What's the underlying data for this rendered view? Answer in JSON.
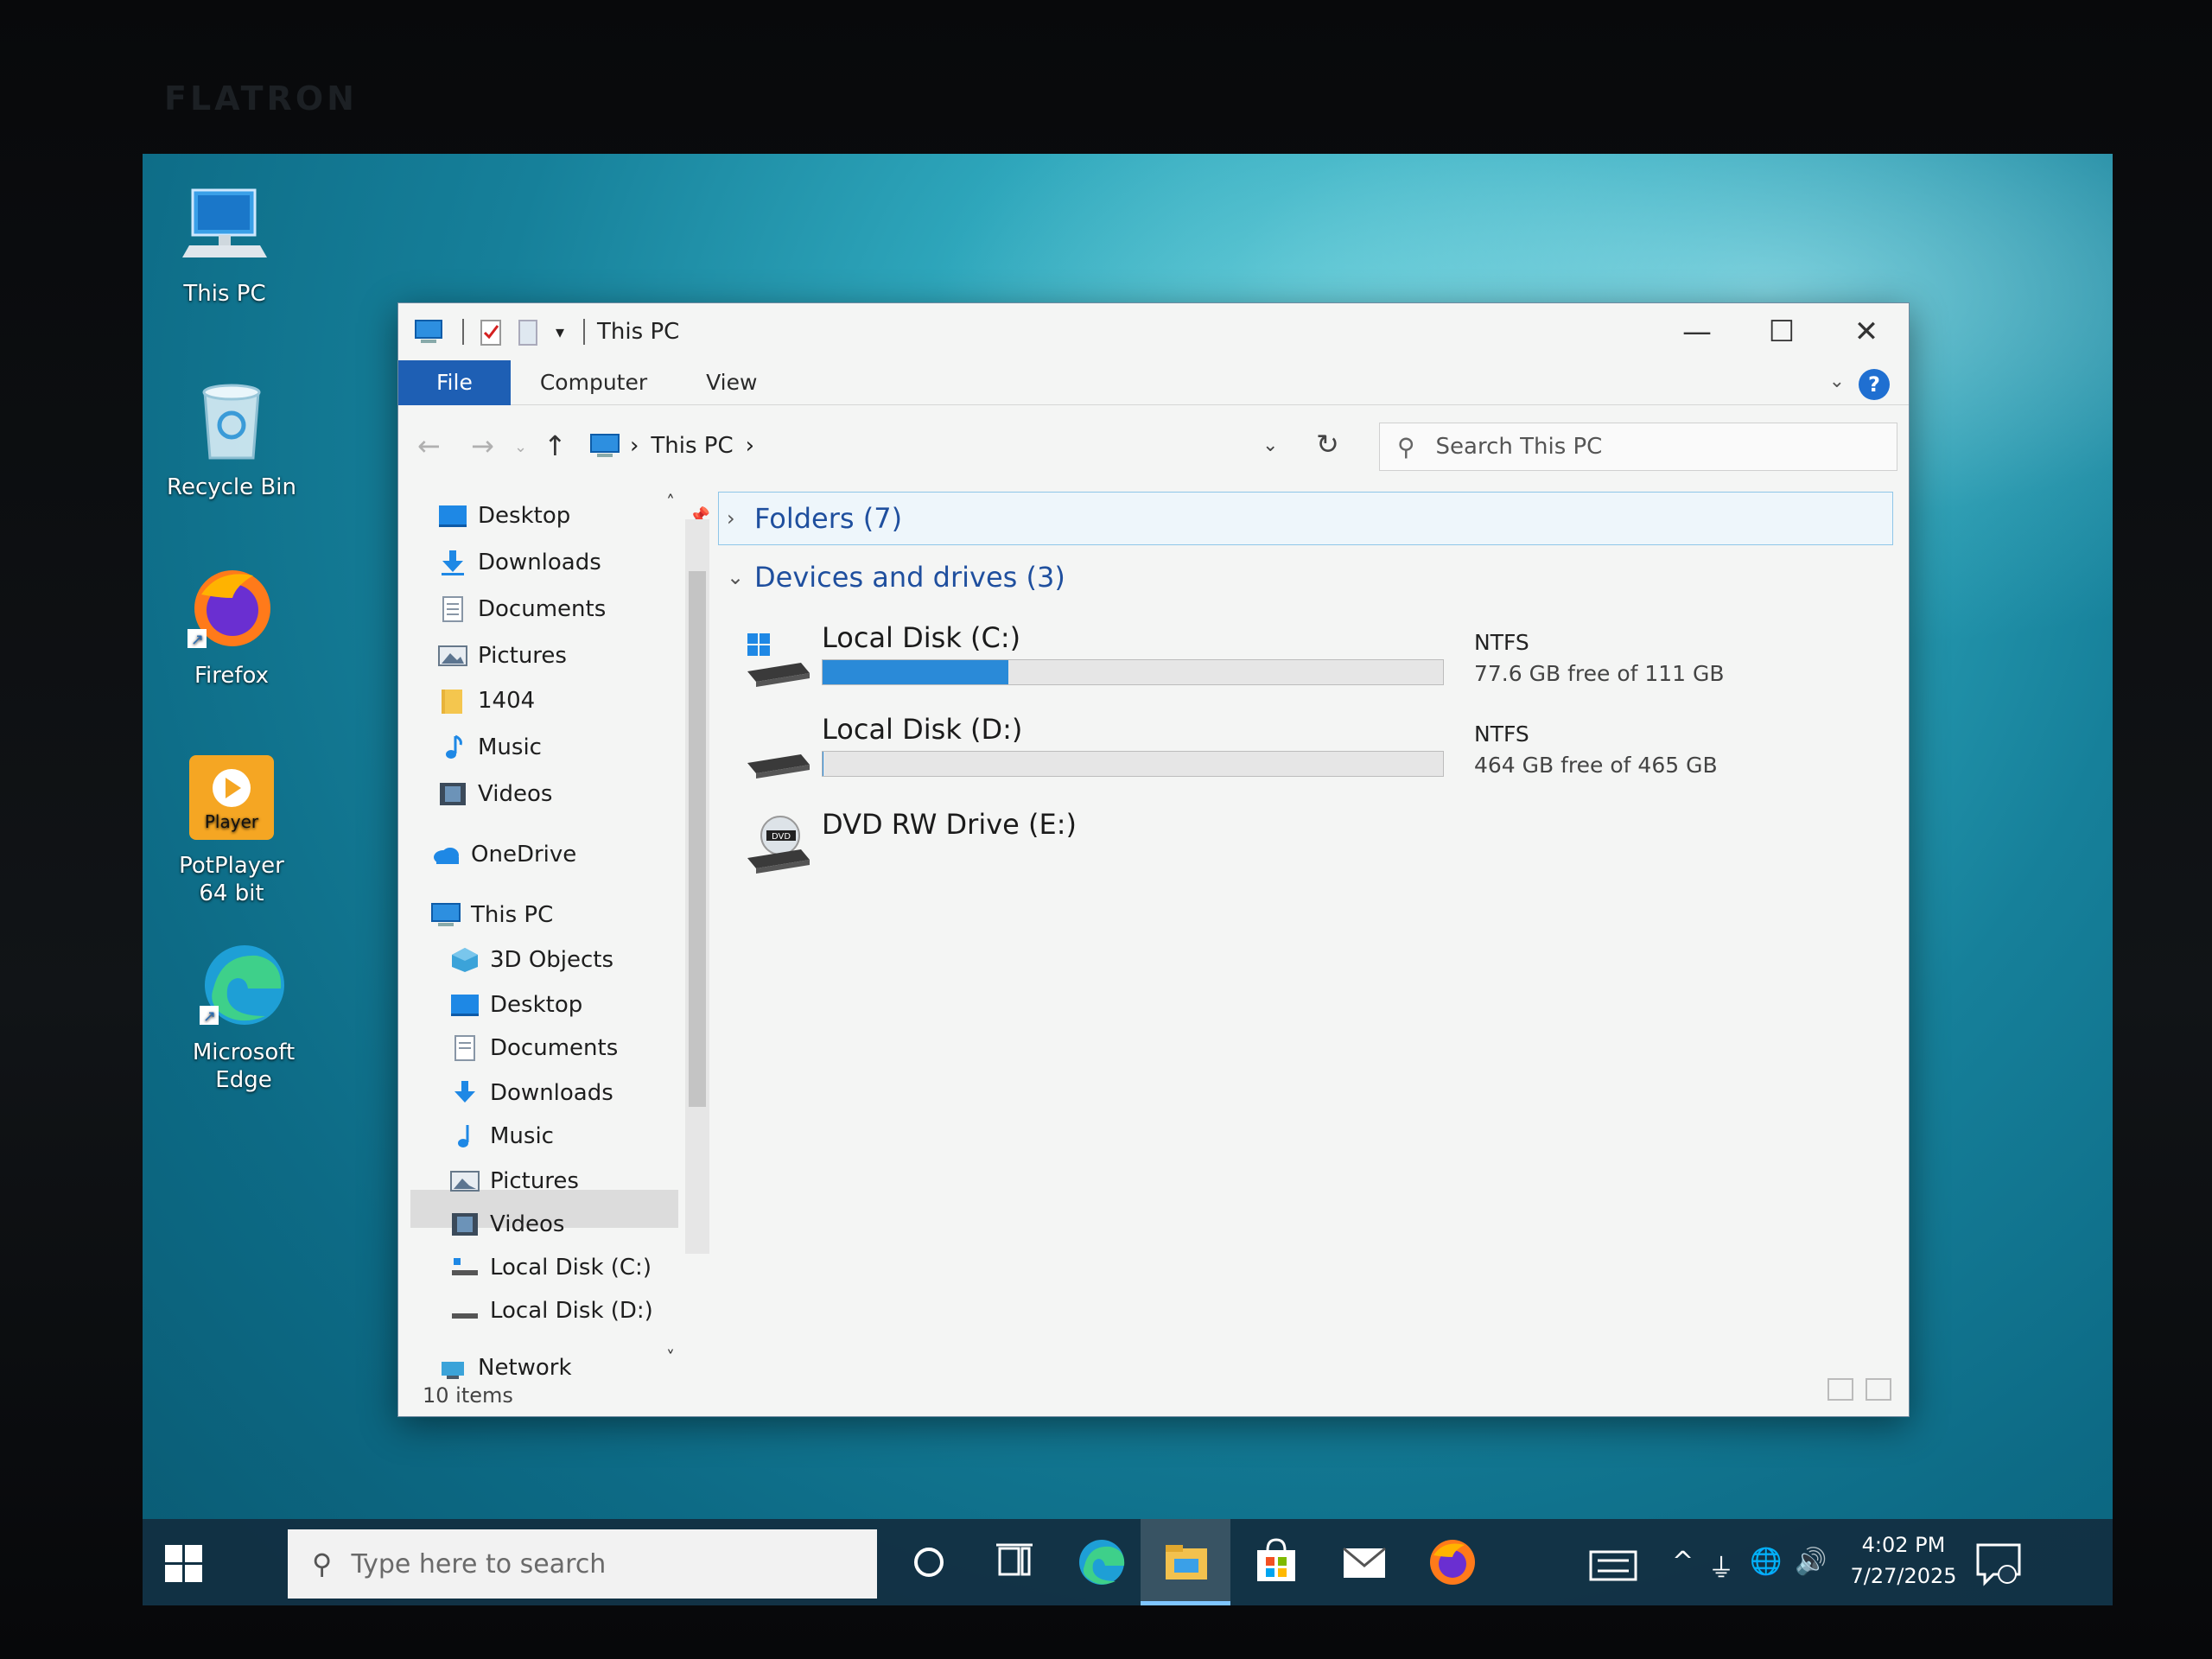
{
  "monitor": {
    "brand": "FLATRON"
  },
  "desktop": {
    "icons": [
      {
        "label": "This PC",
        "icon": "this-pc-icon"
      },
      {
        "label": "Recycle Bin",
        "icon": "recycle-bin-icon"
      },
      {
        "label": "Firefox",
        "icon": "firefox-icon"
      },
      {
        "label": "PotPlayer 64 bit",
        "icon": "potplayer-icon",
        "glyph_text": "Player"
      },
      {
        "label": "Microsoft Edge",
        "icon": "edge-icon"
      }
    ]
  },
  "window": {
    "title": "This PC",
    "controls": {
      "minimize": "—",
      "maximize": "☐",
      "close": "✕"
    },
    "ribbon_tabs": [
      "File",
      "Computer",
      "View"
    ],
    "help": "?",
    "address": {
      "location": "This PC",
      "sep": "›"
    },
    "search_placeholder": "Search This PC",
    "nav": {
      "quick_access": [
        {
          "label": "Desktop",
          "icon": "desktop-folder-icon",
          "pinned": true
        },
        {
          "label": "Downloads",
          "icon": "downloads-icon",
          "pinned": true
        },
        {
          "label": "Documents",
          "icon": "documents-icon",
          "pinned": true
        },
        {
          "label": "Pictures",
          "icon": "pictures-icon",
          "pinned": true
        },
        {
          "label": "1404",
          "icon": "folder-icon",
          "pinned": false
        },
        {
          "label": "Music",
          "icon": "music-icon",
          "pinned": false
        },
        {
          "label": "Videos",
          "icon": "videos-icon",
          "pinned": false
        }
      ],
      "onedrive": "OneDrive",
      "this_pc": "This PC",
      "this_pc_children": [
        {
          "label": "3D Objects",
          "icon": "3d-objects-icon"
        },
        {
          "label": "Desktop",
          "icon": "desktop-folder-icon"
        },
        {
          "label": "Documents",
          "icon": "documents-icon"
        },
        {
          "label": "Downloads",
          "icon": "downloads-icon"
        },
        {
          "label": "Music",
          "icon": "music-icon"
        },
        {
          "label": "Pictures",
          "icon": "pictures-icon"
        },
        {
          "label": "Videos",
          "icon": "videos-icon"
        },
        {
          "label": "Local Disk (C:)",
          "icon": "drive-icon"
        },
        {
          "label": "Local Disk (D:)",
          "icon": "drive-icon"
        }
      ],
      "network": "Network"
    },
    "groups": {
      "folders": "Folders (7)",
      "devices": "Devices and drives (3)"
    },
    "drives": [
      {
        "name": "Local Disk (C:)",
        "fs": "NTFS",
        "free_text": "77.6 GB free of 111 GB",
        "used_fraction": 0.3,
        "icon": "windows-drive-icon"
      },
      {
        "name": "Local Disk (D:)",
        "fs": "NTFS",
        "free_text": "464 GB free of 465 GB",
        "used_fraction": 0.002,
        "icon": "drive-icon"
      },
      {
        "name": "DVD RW Drive (E:)",
        "icon": "dvd-drive-icon",
        "glyph_text": "DVD"
      }
    ],
    "status": "10 items"
  },
  "taskbar": {
    "search_placeholder": "Type here to search",
    "time": "4:02 PM",
    "date": "7/27/2025",
    "accent": "#2a8ad8"
  }
}
